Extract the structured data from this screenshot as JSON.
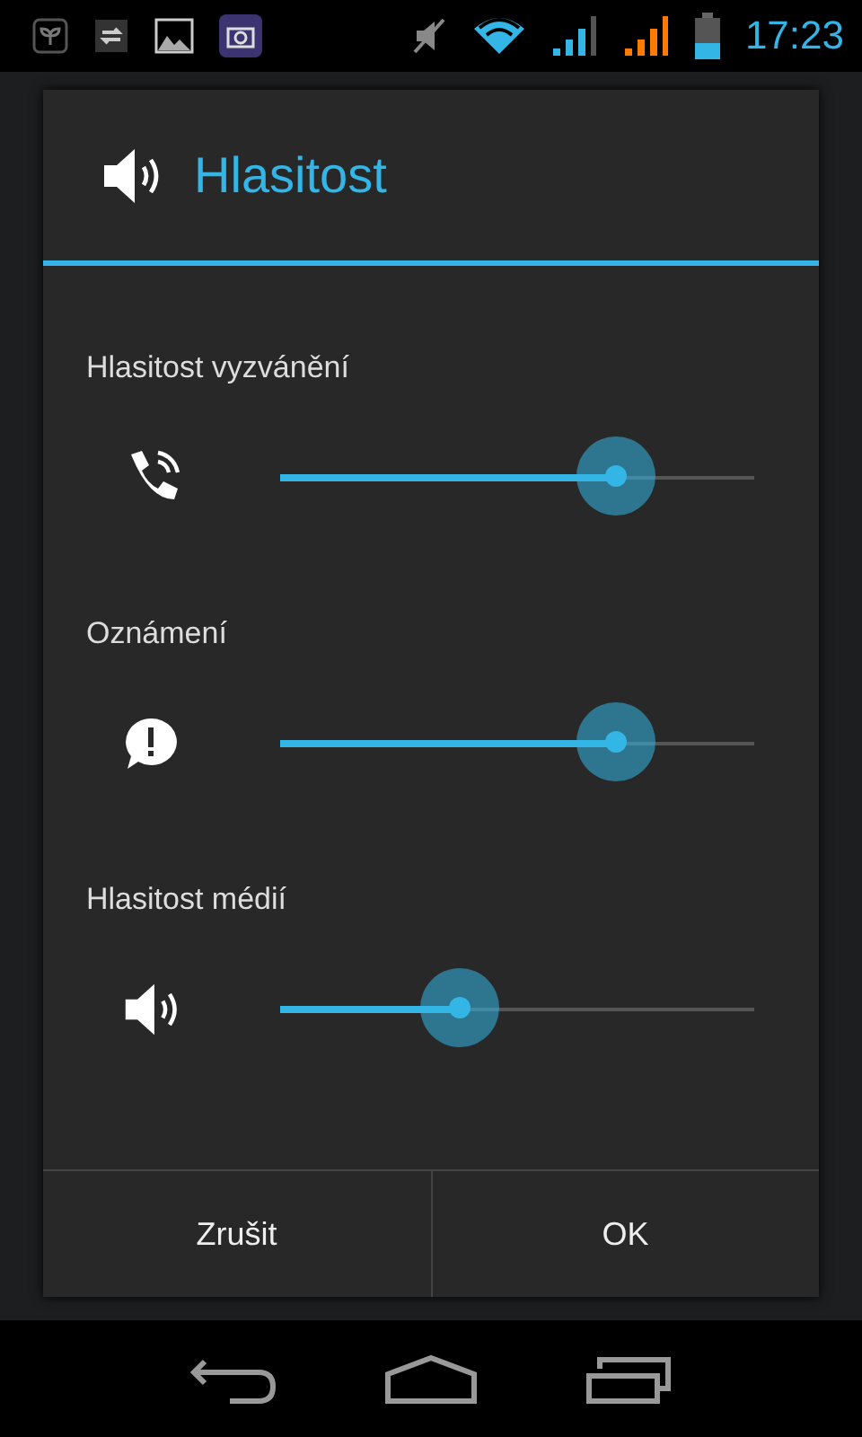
{
  "status_bar": {
    "time": "17:23"
  },
  "dialog": {
    "title": "Hlasitost",
    "sliders": [
      {
        "label": "Hlasitost vyzvánění",
        "kind": "ringtone",
        "level": 0.71
      },
      {
        "label": "Oznámení",
        "kind": "notification",
        "level": 0.71
      },
      {
        "label": "Hlasitost médií",
        "kind": "media",
        "level": 0.38
      }
    ],
    "buttons": [
      "Zrušit",
      "OK"
    ]
  }
}
